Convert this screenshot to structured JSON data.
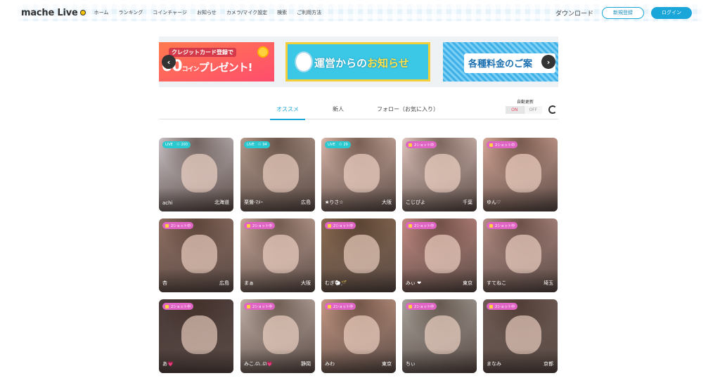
{
  "header": {
    "logo": "mache Live",
    "nav": [
      "ホーム",
      "ランキング",
      "コインチャージ",
      "お知らせ",
      "カメラ/マイク設定",
      "検索",
      "ご利用方法"
    ],
    "download": "ダウンロード",
    "register": "新規登録",
    "login": "ログイン"
  },
  "banners": {
    "b1_line1": "クレジットカード登録で",
    "b1_line2": "00",
    "b1_coin": "コイン",
    "b1_present": "プレゼント!",
    "b2_a": "運営からの",
    "b2_b": "お知らせ",
    "b3": "各種料金のご案",
    "prev_icon": "chevron-left-icon",
    "next_icon": "chevron-right-icon"
  },
  "tabs": {
    "recommended": "オススメ",
    "new": "新人",
    "follow": "フォロー（お気に入り）",
    "auto_update": "自動更新",
    "on": "ON",
    "off": "OFF"
  },
  "performers": [
    {
      "name": "achi",
      "area": "北海道",
      "badge": "LIVE",
      "viewers": "200",
      "type": "live",
      "color": "#c9c2c6"
    },
    {
      "name": "栗鶯-ﾏﾒｰ",
      "area": "広島",
      "badge": "LIVE",
      "viewers": "94",
      "type": "live",
      "color": "#b39a8c"
    },
    {
      "name": "★りさ☆",
      "area": "大阪",
      "badge": "LIVE",
      "viewers": "29",
      "type": "live",
      "color": "#d9b6a8"
    },
    {
      "name": "こじぴよ",
      "area": "千葉",
      "badge": "2ショット中",
      "type": "two",
      "color": "#e3c8bf"
    },
    {
      "name": "ゆん♡",
      "area": "",
      "badge": "2ショット中",
      "type": "two",
      "color": "#d8a898"
    },
    {
      "name": "杏",
      "area": "広島",
      "badge": "2ショット中",
      "type": "two",
      "color": "#8f6f62"
    },
    {
      "name": "まぁ",
      "area": "大阪",
      "badge": "2ショット中",
      "type": "two",
      "color": "#c9a99b"
    },
    {
      "name": "むぎ🐑🪄",
      "area": "",
      "badge": "2ショット中",
      "type": "two",
      "color": "#8a6b50"
    },
    {
      "name": "みぃ ❤",
      "area": "東京",
      "badge": "2ショット中",
      "type": "two",
      "color": "#c68c84"
    },
    {
      "name": "すてねこ",
      "area": "埼玉",
      "badge": "2ショット中",
      "type": "two",
      "color": "#b88f87"
    },
    {
      "name": "あ💗",
      "area": "",
      "badge": "2ショット中",
      "type": "two",
      "color": "#4a3a38"
    },
    {
      "name": "みこ.ᘏ..ᘏ💗",
      "area": "静岡",
      "badge": "2ショット中",
      "type": "two",
      "color": "#c2b2a8"
    },
    {
      "name": "みわ",
      "area": "東京",
      "badge": "2ショット中",
      "type": "two",
      "color": "#c89a85"
    },
    {
      "name": "ちぃ",
      "area": "",
      "badge": "2ショット中",
      "type": "two",
      "color": "#a8a49c"
    },
    {
      "name": "まなみ",
      "area": "京都",
      "badge": "2ショット中",
      "type": "two",
      "color": "#6f5b54"
    }
  ]
}
